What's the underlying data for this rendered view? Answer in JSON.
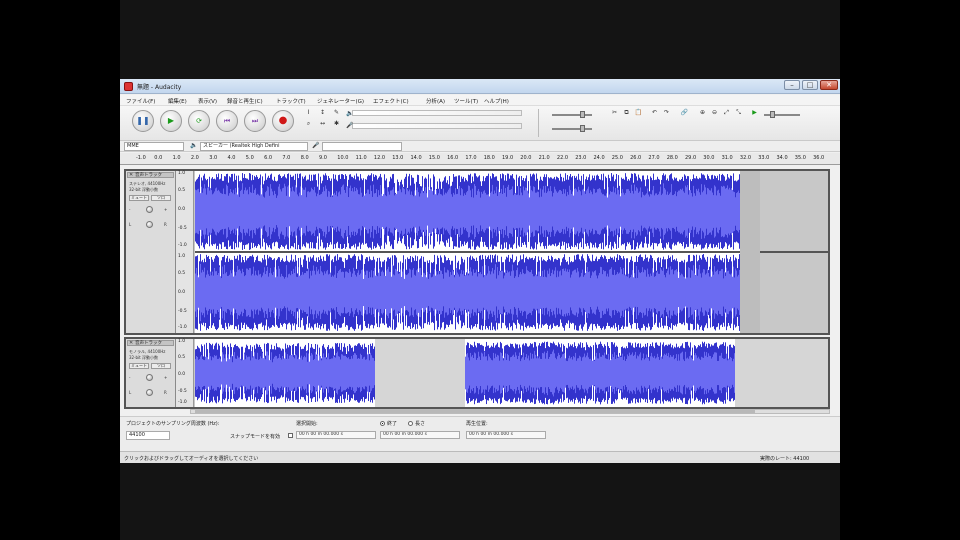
{
  "window": {
    "title": "無題 - Audacity"
  },
  "menu": [
    "ファイル(F)",
    "編集(E)",
    "表示(V)",
    "録音と再生(C)",
    "トラック(T)",
    "ジェネレーター(G)",
    "エフェクト(C)",
    "分析(A)",
    "ツール(T)",
    "ヘルプ(H)"
  ],
  "transport": {
    "pause": "pause",
    "play": "play",
    "loop": "loop",
    "skip_start": "skip-to-start",
    "skip_end": "skip-to-end",
    "record": "record"
  },
  "colors": {
    "waveform": "#3333cc",
    "waveform_light": "#6b6bf2",
    "background": "#000000",
    "record": "#d01818",
    "play": "#1a9a1a"
  },
  "devices": {
    "host": "MME",
    "output": "スピーカー (Realtek High Defini"
  },
  "ruler": {
    "labels": [
      "-1.0",
      "0.0",
      "1.0",
      "2.0",
      "3.0",
      "4.0",
      "5.0",
      "6.0",
      "7.0",
      "8.0",
      "9.0",
      "10.0",
      "11.0",
      "12.0",
      "13.0",
      "14.0",
      "15.0",
      "16.0",
      "17.0",
      "18.0",
      "19.0",
      "20.0",
      "21.0",
      "22.0",
      "23.0",
      "24.0",
      "25.0",
      "26.0",
      "27.0",
      "28.0",
      "29.0",
      "30.0",
      "31.0",
      "32.0",
      "33.0",
      "34.0",
      "35.0",
      "36.0"
    ]
  },
  "tracks": [
    {
      "name": "音声トラック",
      "info": [
        "ステレオ, 44100Hz",
        "32-bit 浮動小数"
      ],
      "mute": "ミュート",
      "solo": "ソロ",
      "scale": [
        "1.0",
        "0.5",
        "0.0",
        "-0.5",
        "-1.0"
      ]
    },
    {
      "name": "音声トラック",
      "info": [
        "モノラル, 44100Hz",
        "32-bit 浮動小数"
      ],
      "mute": "ミュート",
      "solo": "ソロ",
      "scale": [
        "1.0",
        "0.5",
        "0.0",
        "-0.5",
        "-1.0"
      ]
    }
  ],
  "selection_toolbar": {
    "rate_label": "プロジェクトのサンプリング周波数 (Hz):",
    "rate_value": "44100",
    "snap_label": "スナップモードを有効",
    "start_label": "選択開始:",
    "end_radio": "終了",
    "length_radio": "長さ",
    "position_label": "再生位置:",
    "time_value": "00 h 00 m 00.000 s"
  },
  "status": {
    "left": "クリックおよびドラッグしてオーディオを選択してください",
    "right": "実際のレート: 44100"
  }
}
